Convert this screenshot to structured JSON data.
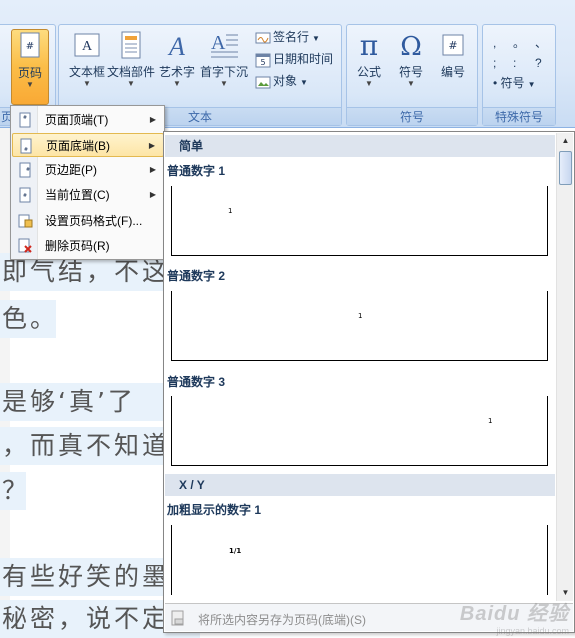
{
  "ribbon": {
    "groups": {
      "header_footer_partial_label": "页",
      "text_label": "文本",
      "symbols_label": "符号",
      "special_label": "特殊符号"
    },
    "buttons": {
      "page_number": "页码",
      "text_box": "文本框",
      "quick_parts": "文档部件",
      "wordart": "艺术字",
      "drop_cap": "首字下沉",
      "signature_line": "签名行",
      "date_time": "日期和时间",
      "object": "对象",
      "equation": "公式",
      "symbol": "符号",
      "numbering": "编号",
      "special_symbol": "符号"
    },
    "special_chars": [
      ",",
      "。",
      "、",
      ";",
      ":",
      "?",
      "•"
    ]
  },
  "menu": {
    "items": [
      {
        "label": "页面顶端(T)",
        "submenu": true
      },
      {
        "label": "页面底端(B)",
        "submenu": true
      },
      {
        "label": "页边距(P)",
        "submenu": true
      },
      {
        "label": "当前位置(C)",
        "submenu": true
      },
      {
        "label": "设置页码格式(F)...",
        "submenu": false
      },
      {
        "label": "删除页码(R)",
        "submenu": false
      }
    ]
  },
  "gallery": {
    "category_simple": "简单",
    "items": [
      {
        "title": "普通数字 1",
        "sample": "1"
      },
      {
        "title": "普通数字 2",
        "sample": "1"
      },
      {
        "title": "普通数字 3",
        "sample": "1"
      }
    ],
    "category_xy": "X / Y",
    "item_bold": {
      "title": "加粗显示的数字 1",
      "sample": "1/1"
    },
    "footer_label": "将所选内容另存为页码(底端)(S)"
  },
  "document": {
    "lines": [
      "即气结，不这",
      "色。",
      "是够‘真’了",
      "，而真不知道",
      "？",
      "有些好笑的墨",
      "秘密，说不定"
    ]
  },
  "watermark": {
    "brand": "Baidu 经验",
    "url": "jingyan.baidu.com"
  },
  "colors": {
    "accent": "#fbbd47",
    "ribbon": "#dbe8f8",
    "menu_highlight": "#fde5a6"
  }
}
